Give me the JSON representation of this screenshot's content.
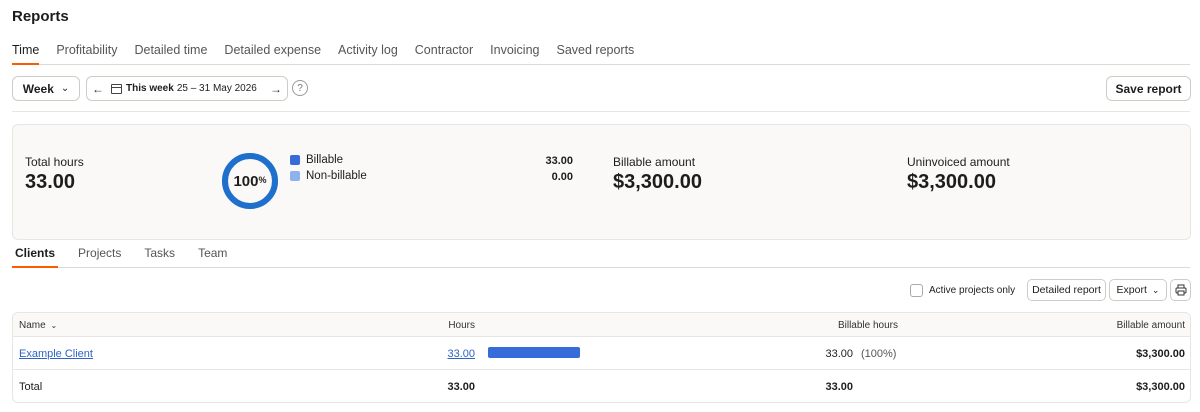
{
  "page": {
    "title": "Reports"
  },
  "top_tabs": [
    {
      "label": "Time",
      "active": true
    },
    {
      "label": "Profitability",
      "active": false
    },
    {
      "label": "Detailed time",
      "active": false
    },
    {
      "label": "Detailed expense",
      "active": false
    },
    {
      "label": "Activity log",
      "active": false
    },
    {
      "label": "Contractor",
      "active": false
    },
    {
      "label": "Invoicing",
      "active": false
    },
    {
      "label": "Saved reports",
      "active": false
    }
  ],
  "toolbar": {
    "period_label": "Week",
    "range_strong": "This week",
    "range_dates": "25 – 31 May 2026",
    "help_label": "?",
    "save_label": "Save report"
  },
  "summary": {
    "total_hours_label": "Total hours",
    "total_hours_value": "33.00",
    "donut_percent": "100",
    "donut_suffix": "%",
    "billable_fraction": 1.0,
    "legend": [
      {
        "label": "Billable",
        "value": "33.00",
        "color": "#376bd9"
      },
      {
        "label": "Non-billable",
        "value": "0.00",
        "color": "#8fb2ee"
      }
    ],
    "billable_amount_label": "Billable amount",
    "billable_amount_value": "$3,300.00",
    "uninvoiced_amount_label": "Uninvoiced amount",
    "uninvoiced_amount_value": "$3,300.00"
  },
  "sub_tabs": [
    {
      "label": "Clients",
      "active": true
    },
    {
      "label": "Projects",
      "active": false
    },
    {
      "label": "Tasks",
      "active": false
    },
    {
      "label": "Team",
      "active": false
    }
  ],
  "table_tools": {
    "active_projects_label": "Active projects only",
    "detailed_report_label": "Detailed report",
    "export_label": "Export"
  },
  "table": {
    "headers": {
      "name": "Name",
      "hours": "Hours",
      "billable_hours": "Billable hours",
      "billable_amount": "Billable amount"
    },
    "rows": [
      {
        "name": "Example Client",
        "hours": "33.00",
        "hours_fraction": 1.0,
        "billable_hours": "33.00",
        "billable_pct": "(100%)",
        "billable_amount": "$3,300.00"
      }
    ],
    "total": {
      "label": "Total",
      "hours": "33.00",
      "billable_hours": "33.00",
      "billable_amount": "$3,300.00"
    }
  },
  "colors": {
    "accent": "#fa5d00",
    "billable": "#376bd9",
    "link": "#2f63c6"
  }
}
